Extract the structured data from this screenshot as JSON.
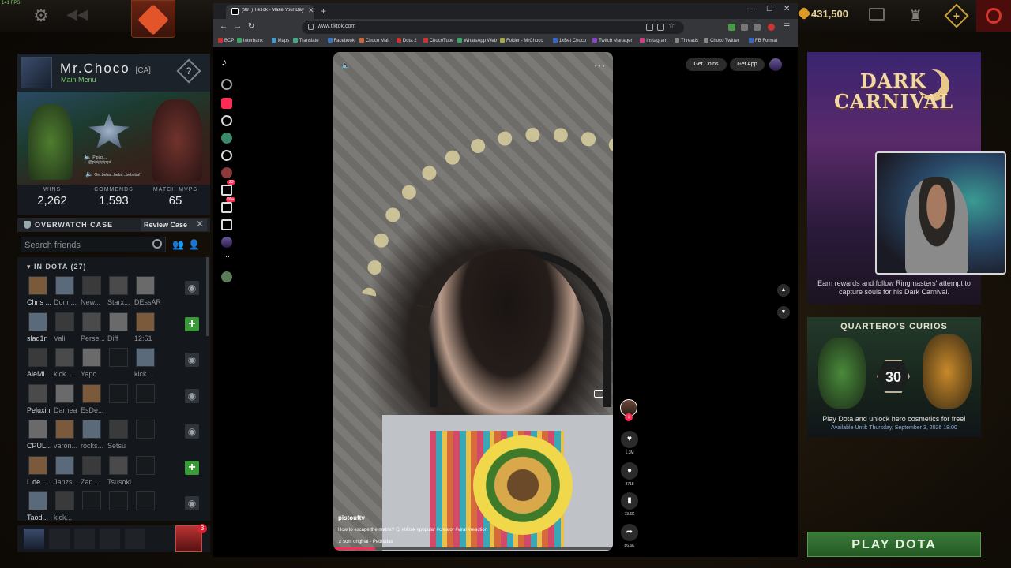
{
  "topbar": {
    "fps": "141 FPS",
    "gold": "431,500"
  },
  "profile": {
    "name": "Mr.Choco",
    "tag": "[CA]",
    "subtitle": "Main Menu",
    "help": "?",
    "voice_line1": "Pipi pi...",
    "voice_line2": "@pipipipipipi",
    "voice_line3": "Oe..beba...beba...bebeba!!"
  },
  "stats": [
    {
      "label": "WINS",
      "value": "2,262"
    },
    {
      "label": "COMMENDS",
      "value": "1,593"
    },
    {
      "label": "MATCH MVPS",
      "value": "65"
    }
  ],
  "overwatch": {
    "title": "OVERWATCH CASE",
    "button": "Review Case"
  },
  "friends": {
    "search_placeholder": "Search friends",
    "section": "IN DOTA (27)",
    "rows": [
      {
        "names": [
          "Chris ...",
          "Donn...",
          "New...",
          "Starx...",
          "DEssAR"
        ],
        "action": "eye"
      },
      {
        "names": [
          "slad1n",
          "Vali",
          "Perse...",
          "Diff",
          "12:51"
        ],
        "action": "plus"
      },
      {
        "names": [
          "AleMi...",
          "kick...",
          "Yapo",
          "",
          "kick..."
        ],
        "action": "eye"
      },
      {
        "names": [
          "Peluxin",
          "Darnea",
          "EsDe...",
          "",
          ""
        ],
        "action": "eye"
      },
      {
        "names": [
          "CPUL...",
          "varon...",
          "rocks...",
          "Setsu",
          ""
        ],
        "action": "eye"
      },
      {
        "names": [
          "L de ...",
          "Janzs...",
          "Zan...",
          "Tsusoki",
          ""
        ],
        "action": "plus"
      },
      {
        "names": [
          "Taod...",
          "kick...",
          "",
          "",
          ""
        ],
        "action": "eye"
      }
    ]
  },
  "party": {
    "badge": "3"
  },
  "browser": {
    "tab_title": "(99+) TikTok - Make Your Day",
    "url": "www.tiktok.com",
    "bookmarks": [
      "BCP",
      "Interbank",
      "Maps",
      "Translate",
      "Facebook",
      "Choco Mail",
      "Dota 2",
      "ChocoTube",
      "WhatsApp Web",
      "Folder - MrChoco",
      "1xBet Choco",
      "Twitch Manager",
      "Instagram",
      "Threads",
      "Choco Twitter",
      "FB Format"
    ]
  },
  "tiktok": {
    "rail_badges": [
      "23",
      "99+"
    ],
    "get_coins": "Get Coins",
    "get_app": "Get App",
    "author": "pistouftv",
    "caption": "How to escape the matrix? 😏 #tiktok #popular #creator #viral #reaction",
    "sound": "som original - Pedradas",
    "progress": 0.15,
    "counts": {
      "likes": "1.3M",
      "comments": "3718",
      "saves": "73.5K",
      "shares": "86.6K"
    }
  },
  "carnival": {
    "logo_line1": "DARK",
    "logo_line2": "CARNIVAL",
    "desc": "Earn rewards and follow Ringmasters' attempt to capture souls for his Dark Carnival."
  },
  "curios": {
    "title": "QUARTERO'S CURIOS",
    "number": "30",
    "desc": "Play Dota and unlock hero cosmetics for free!",
    "date": "Available Until:  Thursday, September 3, 2026 18:00"
  },
  "play_button": "PLAY DOTA",
  "colors": {
    "tiktok_red": "#fe2c55",
    "play_green": "#3a7a3a",
    "accent_green": "#7ec96e"
  }
}
